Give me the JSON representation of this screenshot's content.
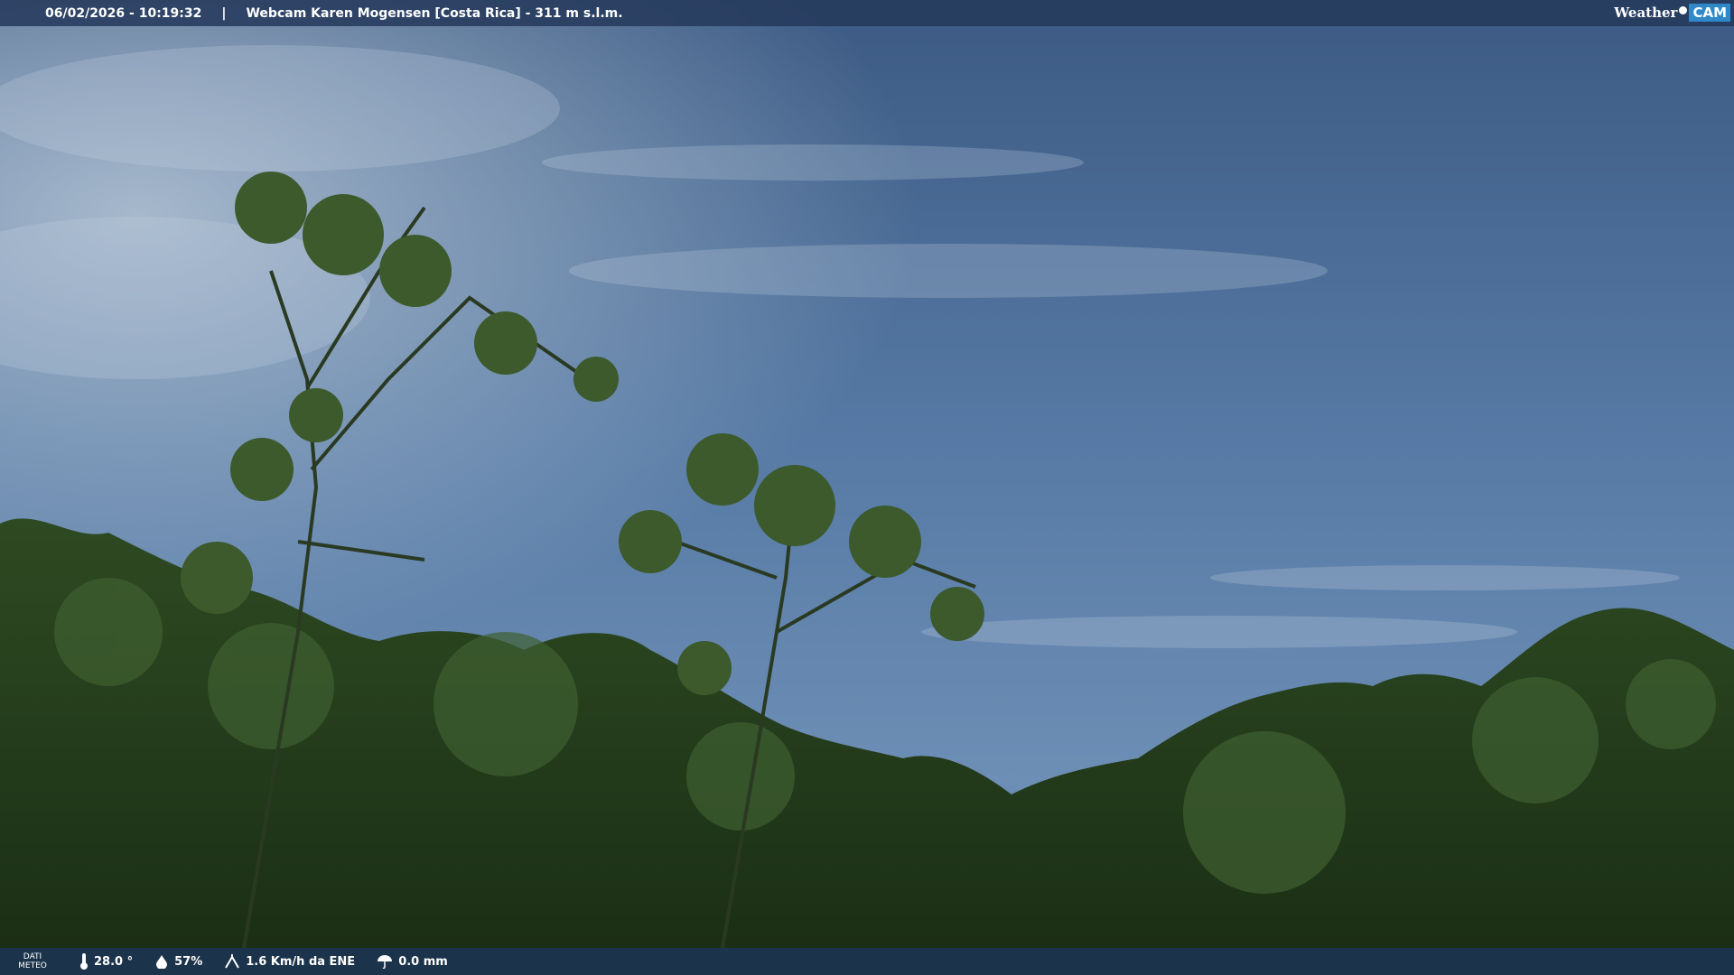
{
  "header": {
    "timestamp": "06/02/2026 - 10:19:32",
    "separator": "|",
    "title": "Webcam Karen Mogensen [Costa Rica] - 311 m s.l.m.",
    "brand_weather": "Weather",
    "brand_cam": "CAM"
  },
  "footer": {
    "dati": "DATI",
    "meteo": "METEO",
    "temperature": "28.0 °",
    "humidity": "57%",
    "wind": "1.6 Km/h da ENE",
    "rain": "0.0 mm",
    "icons": [
      "thermometer-icon",
      "humidity-icon",
      "wind-icon",
      "rain-icon"
    ]
  },
  "colors": {
    "sky_top": "#3c5b86",
    "sky_bottom": "#6a8ab0",
    "foliage": "#1e3a18",
    "bar": "#263a5c",
    "brand_cam": "#2f88c8"
  }
}
